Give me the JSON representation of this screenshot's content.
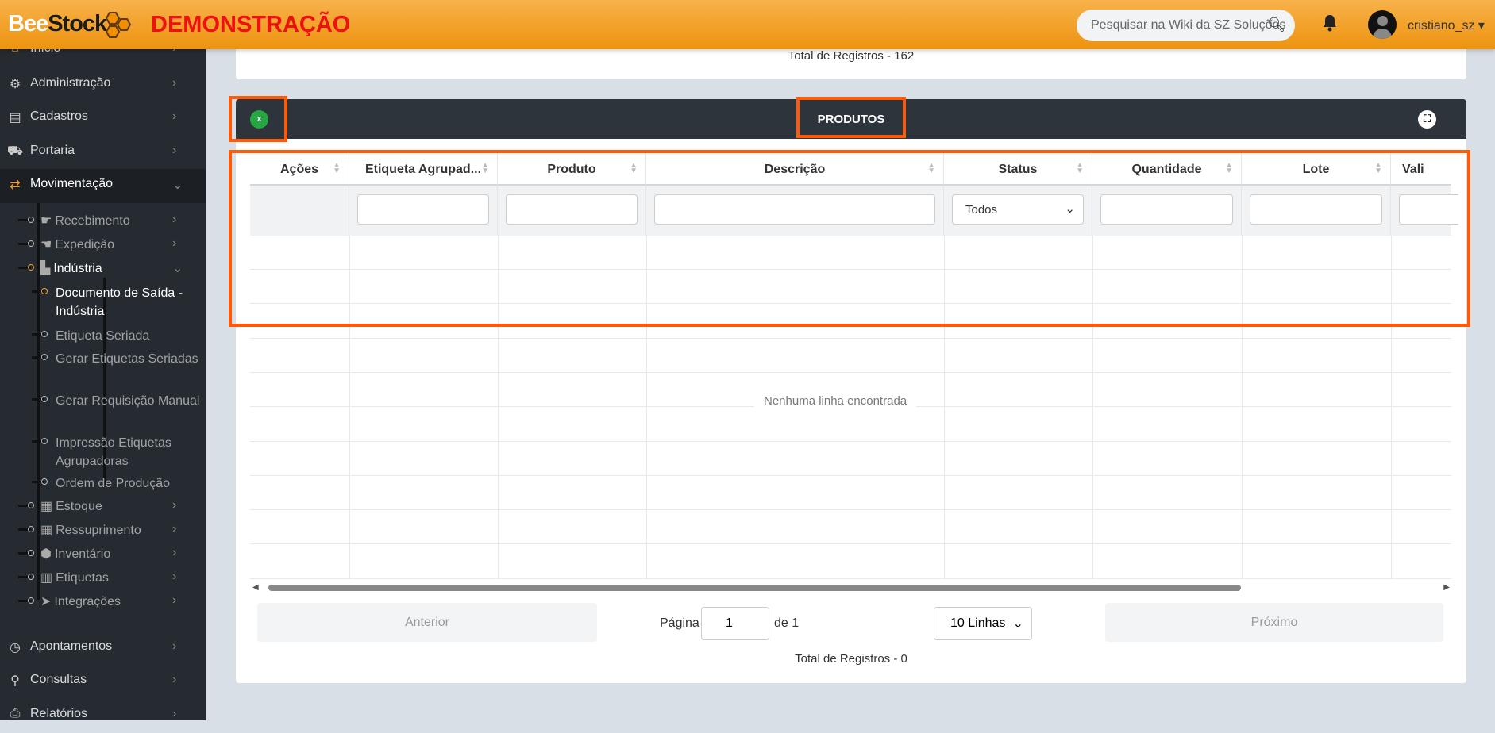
{
  "header": {
    "logo_bee": "Bee",
    "logo_stock": "Stock",
    "demo_label": "DEMONSTRAÇÃO",
    "search_placeholder": "Pesquisar na Wiki da SZ Soluções",
    "username": "cristiano_sz"
  },
  "sidebar": {
    "top": [
      {
        "label": "Início",
        "icon": "⌂"
      },
      {
        "label": "Administração",
        "icon": "⚙"
      },
      {
        "label": "Cadastros",
        "icon": "▤"
      },
      {
        "label": "Portaria",
        "icon": "⛟"
      },
      {
        "label": "Movimentação",
        "icon": "⇄"
      }
    ],
    "movimentacao": [
      {
        "label": "Recebimento",
        "icon": "☛"
      },
      {
        "label": "Expedição",
        "icon": "☚"
      },
      {
        "label": "Indústria",
        "icon": "▙"
      }
    ],
    "industria": [
      "Documento de Saída - Indústria",
      "Etiqueta Seriada",
      "Gerar Etiquetas Seriadas",
      "Gerar Requisição Manual",
      "Impressão Etiquetas Agrupadoras",
      "Ordem de Produção"
    ],
    "mov_more": [
      {
        "label": "Estoque",
        "icon": "▦"
      },
      {
        "label": "Ressuprimento",
        "icon": "▦"
      },
      {
        "label": "Inventário",
        "icon": "⬢"
      },
      {
        "label": "Etiquetas",
        "icon": "▥"
      },
      {
        "label": "Integrações",
        "icon": "➤"
      }
    ],
    "bottom": [
      {
        "label": "Apontamentos",
        "icon": "◷"
      },
      {
        "label": "Consultas",
        "icon": "⚲"
      },
      {
        "label": "Relatórios",
        "icon": "⎙"
      }
    ]
  },
  "top_card": {
    "total": "Total de Registros - 162"
  },
  "panel": {
    "title": "PRODUTOS",
    "columns": [
      "Ações",
      "Etiqueta Agrupad...",
      "Produto",
      "Descrição",
      "Status",
      "Quantidade",
      "Lote",
      "Vali"
    ],
    "status_filter": "Todos",
    "empty": "Nenhuma linha encontrada"
  },
  "pagination": {
    "prev": "Anterior",
    "page_label": "Página",
    "page": "1",
    "of": "de 1",
    "rows": "10 Linhas",
    "next": "Próximo",
    "total": "Total de Registros - 0"
  },
  "colors": {
    "accent": "#ee930f",
    "highlight": "#ff5a0a",
    "sidebar": "#262b31"
  }
}
